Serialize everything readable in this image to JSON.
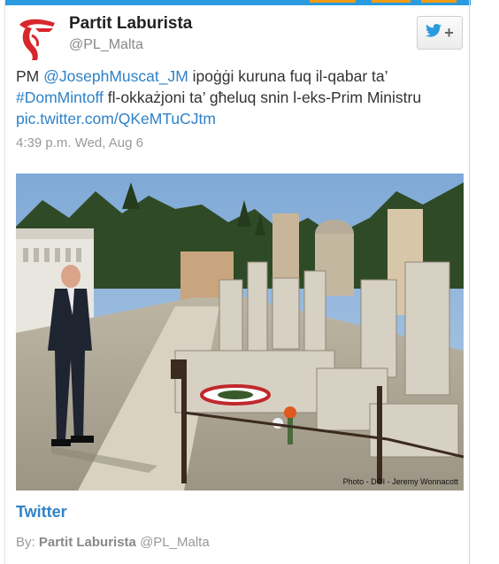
{
  "header": {
    "author_name": "Partit Laburista",
    "handle": "@PL_Malta",
    "follow_plus": "+"
  },
  "tweet": {
    "parts": [
      {
        "text": "PM ",
        "link": false
      },
      {
        "text": "@JosephMuscat_JM",
        "link": true
      },
      {
        "text": " ipoġġi kuruna fuq il-qabar ta’ ",
        "link": false
      },
      {
        "text": "#DomMintoff",
        "link": true
      },
      {
        "text": " fl-okkażjoni ta’ għeluq snin l-eks-Prim Ministru ",
        "link": false
      },
      {
        "text": "pic.twitter.com/QKeMTuCJtm",
        "link": true
      }
    ],
    "timestamp": "4:39 p.m. Wed, Aug 6"
  },
  "photo": {
    "credit": "Photo - DOI - Jeremy Wonnacott",
    "alt": "Prime Minister standing at a grave in a cemetery"
  },
  "footer": {
    "source_label": "Twitter",
    "by_label": "By:",
    "by_name": "Partit Laburista",
    "by_handle": "@PL_Malta"
  },
  "colors": {
    "link": "#2f82c8",
    "twitter_blue": "#2b9be0",
    "muted": "#999999"
  },
  "icons": [
    "party-logo-icon",
    "twitter-bird-icon"
  ]
}
